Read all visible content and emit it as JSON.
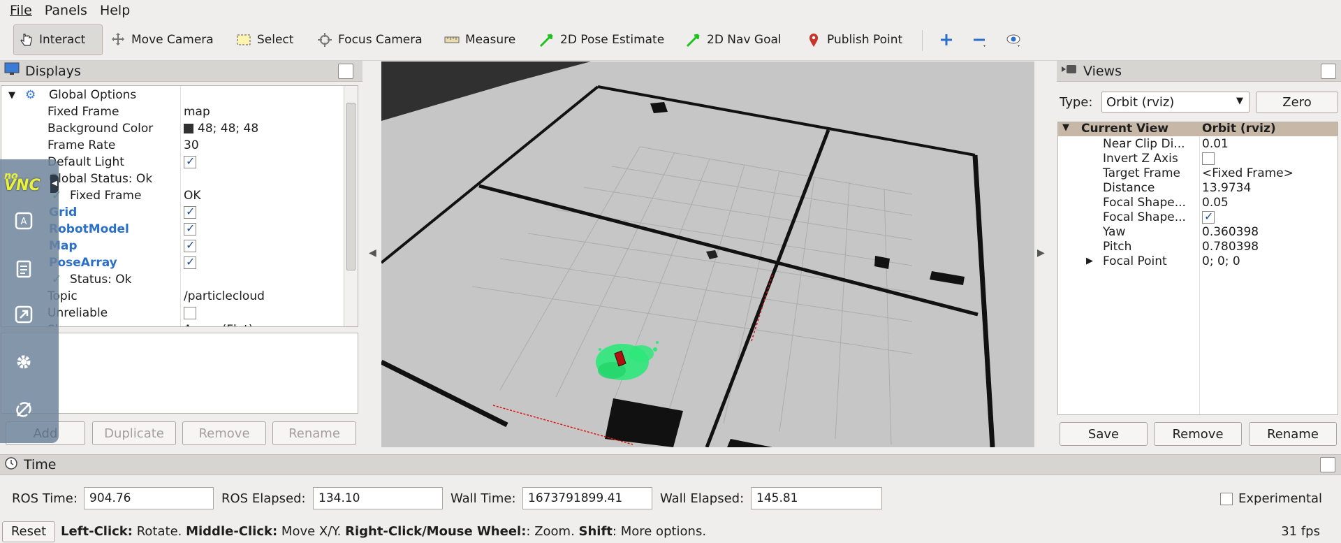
{
  "menubar": {
    "items": [
      "File",
      "Panels",
      "Help"
    ]
  },
  "toolbar": {
    "tools": [
      {
        "label": "Interact",
        "icon": "hand-pointer-icon",
        "active": true
      },
      {
        "label": "Move Camera",
        "icon": "move-camera-icon"
      },
      {
        "label": "Select",
        "icon": "select-rect-icon"
      },
      {
        "label": "Focus Camera",
        "icon": "crosshair-icon"
      },
      {
        "label": "Measure",
        "icon": "ruler-icon"
      },
      {
        "label": "2D Pose Estimate",
        "icon": "green-arrow-icon"
      },
      {
        "label": "2D Nav Goal",
        "icon": "green-arrow-icon"
      },
      {
        "label": "Publish Point",
        "icon": "map-pin-icon"
      }
    ],
    "extra_icons": [
      "plus-icon",
      "minus-icon",
      "eye-icon"
    ]
  },
  "displays": {
    "title": "Displays",
    "rows": [
      {
        "name": "Global Options",
        "value": "",
        "level": 0,
        "expanded": true,
        "icon": "gear-icon"
      },
      {
        "name": "Fixed Frame",
        "value": "map",
        "level": 1
      },
      {
        "name": "Background Color",
        "value": "48; 48; 48",
        "level": 1,
        "swatch": "#303030"
      },
      {
        "name": "Frame Rate",
        "value": "30",
        "level": 1
      },
      {
        "name": "Default Light",
        "value": "",
        "level": 1,
        "check": true
      },
      {
        "name": "Global Status: Ok",
        "value": "",
        "level": 0
      },
      {
        "name": "Fixed Frame",
        "value": "OK",
        "level": 1,
        "status": true
      },
      {
        "name": "Grid",
        "value": "",
        "level": 0,
        "check": true,
        "link": true
      },
      {
        "name": "RobotModel",
        "value": "",
        "level": 0,
        "check": true,
        "link": true
      },
      {
        "name": "Map",
        "value": "",
        "level": 0,
        "check": true,
        "link": true
      },
      {
        "name": "PoseArray",
        "value": "",
        "level": 0,
        "check": true,
        "link": true
      },
      {
        "name": "Status: Ok",
        "value": "",
        "level": 1,
        "status": true
      },
      {
        "name": "Topic",
        "value": "/particlecloud",
        "level": 1
      },
      {
        "name": "Unreliable",
        "value": "",
        "level": 1,
        "check": false
      },
      {
        "name": "Shape",
        "value": "Arrow (Flat)",
        "level": 1
      }
    ],
    "buttons": [
      "Add",
      "Duplicate",
      "Remove",
      "Rename"
    ]
  },
  "views": {
    "title": "Views",
    "type_label": "Type:",
    "type_value": "Orbit (rviz)",
    "zero_label": "Zero",
    "header": {
      "name": "Current View",
      "value": "Orbit (rviz)"
    },
    "rows": [
      {
        "name": "Near Clip Di...",
        "value": "0.01"
      },
      {
        "name": "Invert Z Axis",
        "value": "",
        "check": false
      },
      {
        "name": "Target Frame",
        "value": "<Fixed Frame>"
      },
      {
        "name": "Distance",
        "value": "13.9734"
      },
      {
        "name": "Focal Shape...",
        "value": "0.05"
      },
      {
        "name": "Focal Shape...",
        "value": "",
        "check": true
      },
      {
        "name": "Yaw",
        "value": "0.360398"
      },
      {
        "name": "Pitch",
        "value": "0.780398"
      },
      {
        "name": "Focal Point",
        "value": "0; 0; 0",
        "expandable": true
      }
    ],
    "buttons": [
      "Save",
      "Remove",
      "Rename"
    ]
  },
  "time": {
    "title": "Time",
    "ros_time_label": "ROS Time:",
    "ros_time": "904.76",
    "ros_elapsed_label": "ROS Elapsed:",
    "ros_elapsed": "134.10",
    "wall_time_label": "Wall Time:",
    "wall_time": "1673791899.41",
    "wall_elapsed_label": "Wall Elapsed:",
    "wall_elapsed": "145.81",
    "experimental_label": "Experimental"
  },
  "status": {
    "reset_label": "Reset",
    "hint": [
      {
        "b": "Left-Click:",
        "t": " Rotate. "
      },
      {
        "b": "Middle-Click:",
        "t": " Move X/Y. "
      },
      {
        "b": "Right-Click/Mouse Wheel:",
        "t": ": Zoom. "
      },
      {
        "b": "Shift",
        "t": ": More options."
      }
    ],
    "fps": "31 fps"
  },
  "novnc": {
    "logo_top": "no",
    "logo_bottom": "VNC",
    "items": [
      "keyboard-icon",
      "clipboard-icon",
      "fullscreen-icon",
      "settings-icon",
      "disconnect-icon"
    ]
  },
  "colors": {
    "accent_link": "#2a6fc9",
    "viewport_bg": "#303030",
    "floor": "#c7c7c7",
    "particles": "#2ee87a",
    "robot": "#b01212"
  }
}
